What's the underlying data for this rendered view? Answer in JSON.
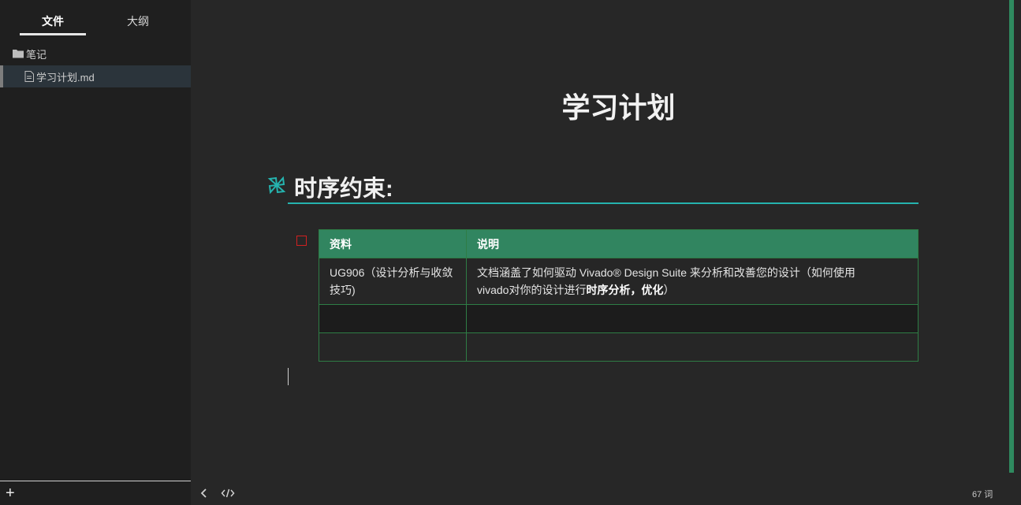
{
  "sidebar": {
    "tabs": [
      {
        "label": "文件",
        "active": true
      },
      {
        "label": "大纲",
        "active": false
      }
    ],
    "folder": {
      "label": "笔记",
      "icon": "folder-icon"
    },
    "file": {
      "label": "学习计划.md",
      "icon": "file-icon",
      "selected": true
    },
    "add_label": "+"
  },
  "document": {
    "title": "学习计划",
    "heading": "时序约束:",
    "heading_icon": "pinwheel-icon",
    "task_checked": false,
    "table": {
      "headers": [
        "资料",
        "说明"
      ],
      "rows": [
        {
          "col1": "UG906（设计分析与收敛技巧)",
          "col2_line1": "文档涵盖了如何驱动 Vivado® Design Suite 来分析和改善您的设计（如何使用",
          "col2_line2_prefix": "vivado对你的设计进行",
          "col2_line2_bold": "时序分析，优化",
          "col2_line2_suffix": "）"
        },
        {
          "col1": "",
          "col2": ""
        },
        {
          "col1": "",
          "col2": ""
        }
      ]
    }
  },
  "statusbar": {
    "word_count": "67 词",
    "back_icon": "chevron-left-icon",
    "source_icon": "code-icon"
  },
  "colors": {
    "accent": "#25b3ae",
    "table_header": "#318560",
    "checkbox": "#d02020",
    "scroll_accent": "#2f8a5f"
  }
}
